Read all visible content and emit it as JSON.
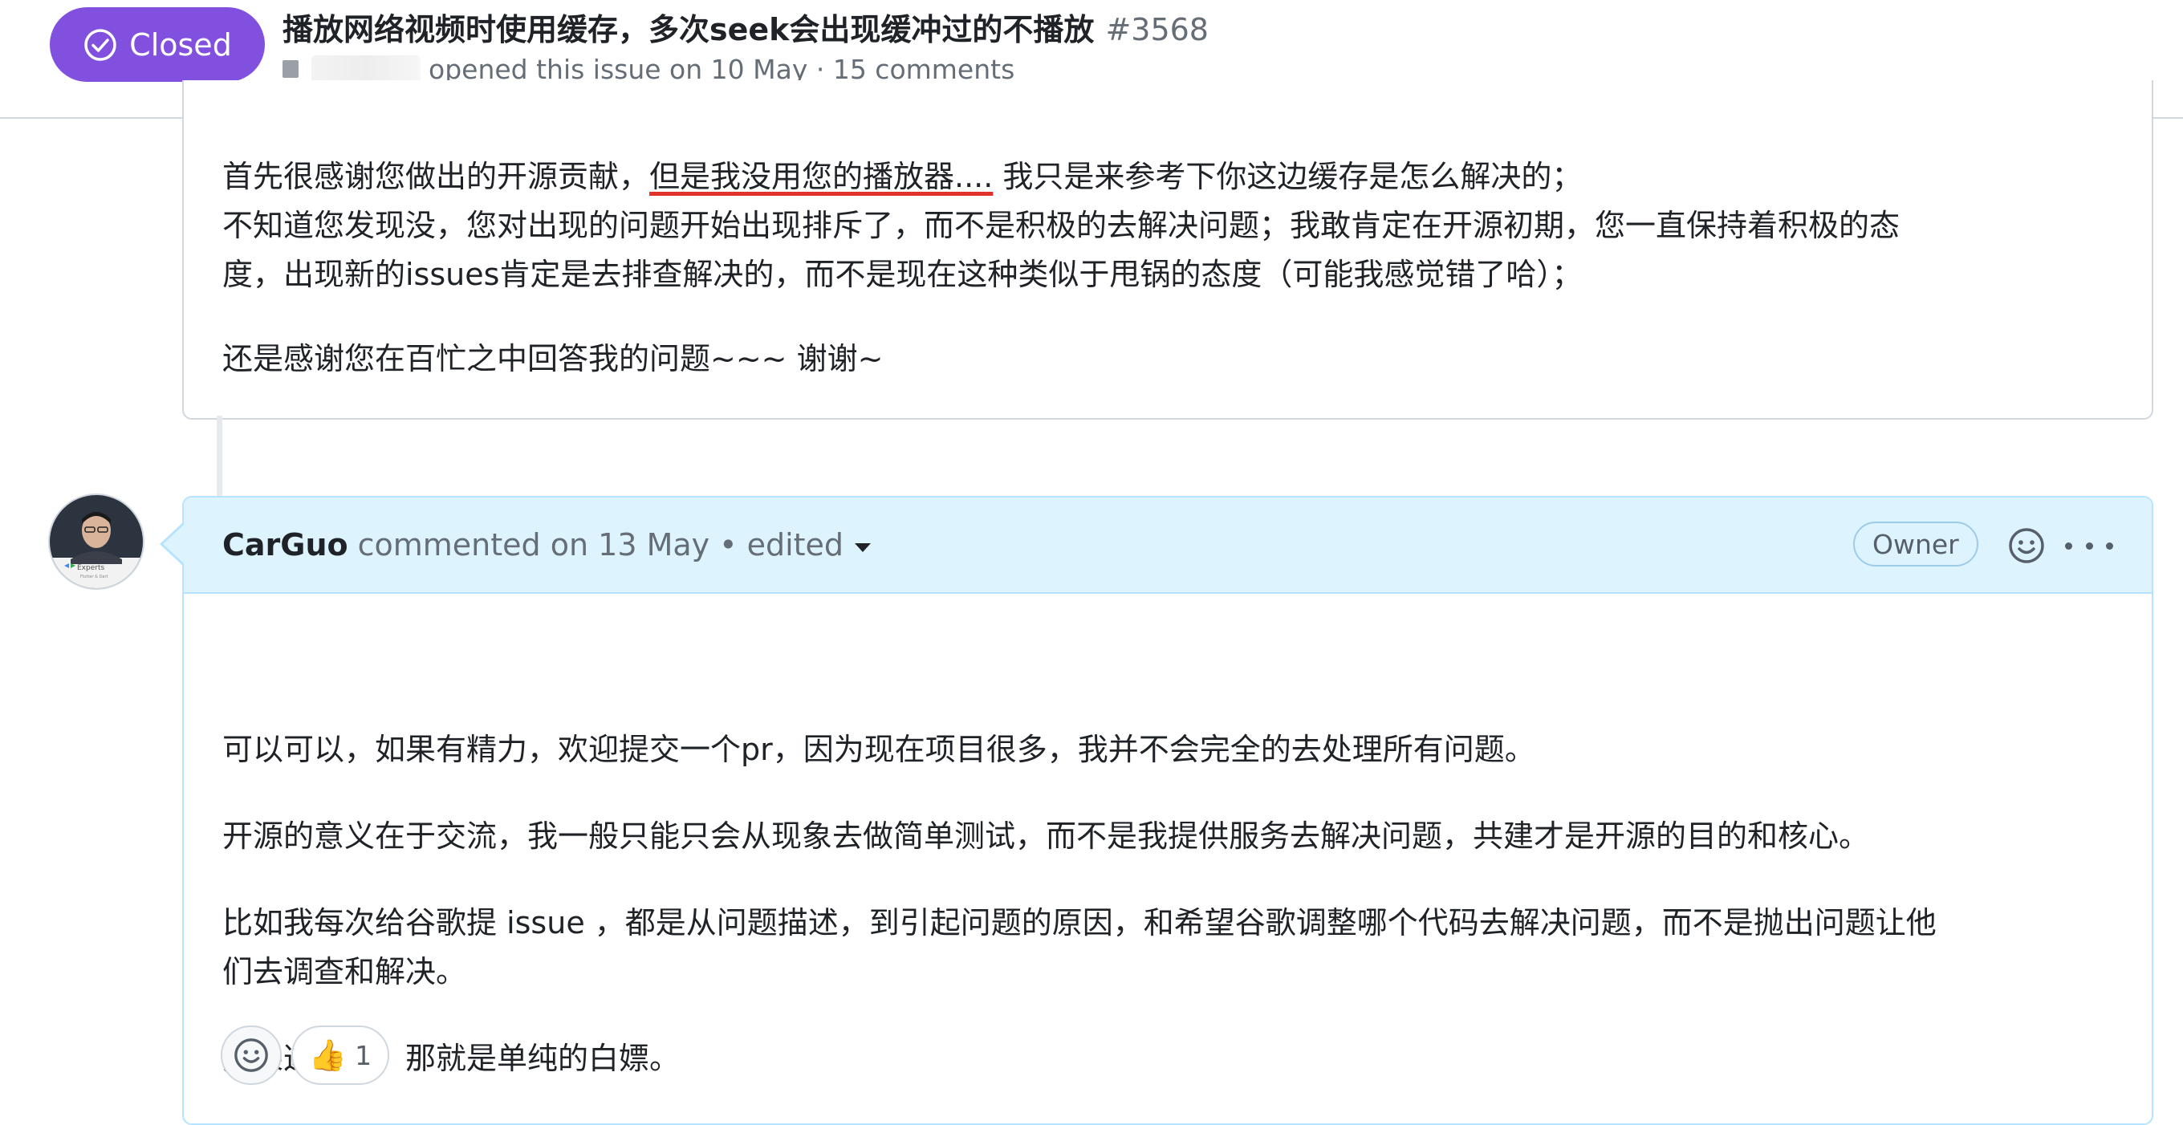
{
  "header": {
    "state_label": "Closed",
    "title": "播放网络视频时使用缓存，多次seek会出现缓冲过的不播放",
    "number": "#3568",
    "meta": "opened this issue on 10 May · 15 comments",
    "state_color": "#8250df"
  },
  "comment_1": {
    "line1_a": "首先很感谢您做出的开源贡献，",
    "line1_highlight": "但是我没用您的播放器....",
    "line1_b": "  我只是来参考下你这边缓存是怎么解决的；",
    "line2": "不知道您发现没，您对出现的问题开始出现排斥了，而不是积极的去解决问题；我敢肯定在开源初期，您一直保持着积极的态",
    "line3": "度，出现新的issues肯定是去排查解决的，而不是现在这种类似于甩锅的态度（可能我感觉错了哈）；",
    "line4": "还是感谢您在百忙之中回答我的问题~~~ 谢谢~",
    "highlight_color": "#e0322b"
  },
  "comment_2": {
    "author": "CarGuo",
    "action": "commented on 13 May",
    "separator": "•",
    "edited": "edited",
    "role": "Owner",
    "avatar_caption": "Experts",
    "avatar_subcaption": "Flutter & Dart",
    "para1": "可以可以，如果有精力，欢迎提交一个pr，因为现在项目很多，我并不会完全的去处理所有问题。",
    "para2": "开源的意义在于交流，我一般只能只会从现象去做简单测试，而不是我提供服务去解决问题，共建才是开源的目的和核心。",
    "para3_line1": "比如我每次给谷歌提 issue ，都是从问题描述，到引起问题的原因，和希望谷歌调整哪个代码去解决问题，而不是抛出问题让他",
    "para3_line2": "们去调查和解决。",
    "para4": "如果这样做，那就是单纯的白嫖。",
    "reactions": [
      {
        "icon": "smiley-icon",
        "emoji": "👍",
        "count": "1"
      }
    ]
  }
}
